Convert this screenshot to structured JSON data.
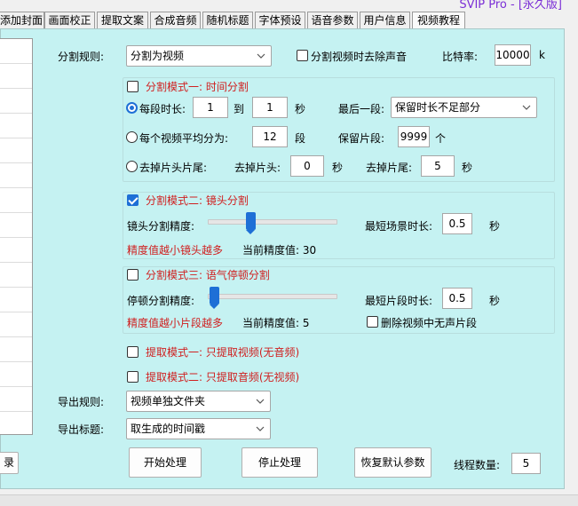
{
  "header": {
    "edition": "SVIP Pro - [永久版]"
  },
  "tabs": [
    {
      "label": "添加封面"
    },
    {
      "label": "画面校正"
    },
    {
      "label": "提取文案"
    },
    {
      "label": "合成音频"
    },
    {
      "label": "随机标题"
    },
    {
      "label": "字体预设"
    },
    {
      "label": "语音参数"
    },
    {
      "label": "用户信息"
    },
    {
      "label": "视频教程"
    }
  ],
  "split": {
    "rule_label": "分割规则:",
    "rule_value": "分割为视频",
    "remove_audio_label": "分割视频时去除声音",
    "remove_audio_checked": false,
    "bitrate_label": "比特率:",
    "bitrate_value": "10000",
    "bitrate_unit": "k"
  },
  "mode1": {
    "title": "分割模式一: 时间分割",
    "checked": false,
    "per_duration_label": "每段时长:",
    "per_duration_from": "1",
    "to_label": "到",
    "per_duration_to": "1",
    "seconds_label": "秒",
    "last_segment_label": "最后一段:",
    "last_segment_value": "保留时长不足部分",
    "avg_label": "每个视频平均分为:",
    "avg_value": "12",
    "avg_unit": "段",
    "keep_label": "保留片段:",
    "keep_value": "9999",
    "keep_unit": "个",
    "trim_label": "去掉片头片尾:",
    "trim_head_label": "去掉片头:",
    "trim_head_value": "0",
    "trim_head_unit": "秒",
    "trim_tail_label": "去掉片尾:",
    "trim_tail_value": "5",
    "trim_tail_unit": "秒",
    "selected_radio": "per_duration"
  },
  "mode2": {
    "title": "分割模式二: 镜头分割",
    "checked": true,
    "precision_label": "镜头分割精度:",
    "slider_fraction": 0.33,
    "min_scene_label": "最短场景时长:",
    "min_scene_value": "0.5",
    "min_scene_unit": "秒",
    "hint": "精度值越小镜头越多",
    "current_label": "当前精度值: 30"
  },
  "mode3": {
    "title": "分割模式三: 语气停顿分割",
    "checked": false,
    "precision_label": "停顿分割精度:",
    "slider_fraction": 0.05,
    "min_clip_label": "最短片段时长:",
    "min_clip_value": "0.5",
    "min_clip_unit": "秒",
    "hint": "精度值越小片段越多",
    "current_label": "当前精度值: 5",
    "delete_silent_label": "删除视频中无声片段",
    "delete_silent_checked": false
  },
  "extract": {
    "mode1": "提取模式一: 只提取视频(无音频)",
    "mode2": "提取模式二: 只提取音频(无视频)"
  },
  "export": {
    "rule_label": "导出规则:",
    "rule_value": "视频单独文件夹",
    "title_label": "导出标题:",
    "title_value": "取生成的时间戳"
  },
  "actions": {
    "left_button": "录",
    "start": "开始处理",
    "stop": "停止处理",
    "restore": "恢复默认参数",
    "threads_label": "线程数量:",
    "threads_value": "5"
  },
  "colors": {
    "panel": "#c5f2f2",
    "accent": "#1e6fd6",
    "warning": "#d02020",
    "edition": "#7b2fd6"
  }
}
